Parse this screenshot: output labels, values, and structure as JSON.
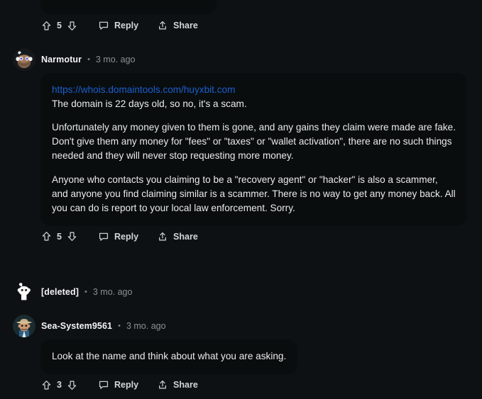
{
  "theme": {
    "page_bg": "#0e1113",
    "bubble_bg": "#0a0d0e",
    "text": "#e9ebec",
    "muted": "#8a9094",
    "link": "#1a5fd0",
    "icon": "#c6cbce"
  },
  "actions": {
    "reply_label": "Reply",
    "share_label": "Share",
    "upvote_icon": "upvote-arrow-icon",
    "downvote_icon": "downvote-arrow-icon",
    "reply_icon": "speech-bubble-icon",
    "share_icon": "share-arrow-icon"
  },
  "separator": "•",
  "comments": [
    {
      "id": "truncated-top",
      "truncated": true,
      "score": "5",
      "reply_label": "Reply",
      "share_label": "Share"
    },
    {
      "id": "narmotur",
      "author": "Narmotur",
      "timestamp": "3 mo. ago",
      "avatar": "snoo-beard-avatar",
      "link": "https://whois.domaintools.com/huyxbit.com",
      "paragraphs": [
        "The domain is 22 days old, so no, it's a scam.",
        "Unfortunately any money given to them is gone, and any gains they claim were made are fake. Don't give them any money for \"fees\" or \"taxes\" or \"wallet activation\", there are no such things needed and they will never stop requesting more money.",
        "Anyone who contacts you claiming to be a \"recovery agent\" or \"hacker\" is also a scammer, and anyone you find claiming similar is a scammer. There is no way to get any money back. All you can do is report to your local law enforcement. Sorry."
      ],
      "score": "5",
      "reply_label": "Reply",
      "share_label": "Share"
    },
    {
      "id": "deleted",
      "author": "[deleted]",
      "timestamp": "3 mo. ago",
      "avatar": "default-snoo-avatar",
      "paragraphs": [],
      "score": "",
      "reply_label": "",
      "share_label": ""
    },
    {
      "id": "sea-system",
      "author": "Sea-System9561",
      "timestamp": "3 mo. ago",
      "avatar": "cowboy-snoo-avatar",
      "paragraphs": [
        "Look at the name and think about what you are asking."
      ],
      "score": "3",
      "reply_label": "Reply",
      "share_label": "Share"
    }
  ]
}
